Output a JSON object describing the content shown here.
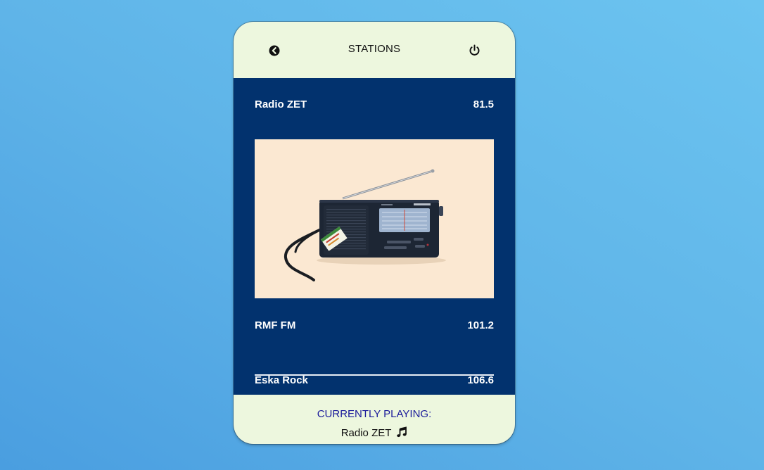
{
  "header": {
    "title": "STATIONS",
    "back_icon": "chevron-left-circle-icon",
    "power_icon": "power-icon"
  },
  "stations": [
    {
      "name": "Radio ZET",
      "frequency": "81.5"
    },
    {
      "name": "RMF FM",
      "frequency": "101.2"
    },
    {
      "name": "Eska Rock",
      "frequency": "106.6"
    }
  ],
  "expanded_station_art": "portable-radio-image",
  "footer": {
    "label": "CURRENTLY PLAYING:",
    "now_playing": "Radio ZET",
    "note_icon": "music-note-icon"
  },
  "colors": {
    "background": "#5fb4e8",
    "panel": "#02326e",
    "header_footer": "#edf7de",
    "label_accent": "#1a1a9a",
    "art_background": "#fbe8d2"
  }
}
